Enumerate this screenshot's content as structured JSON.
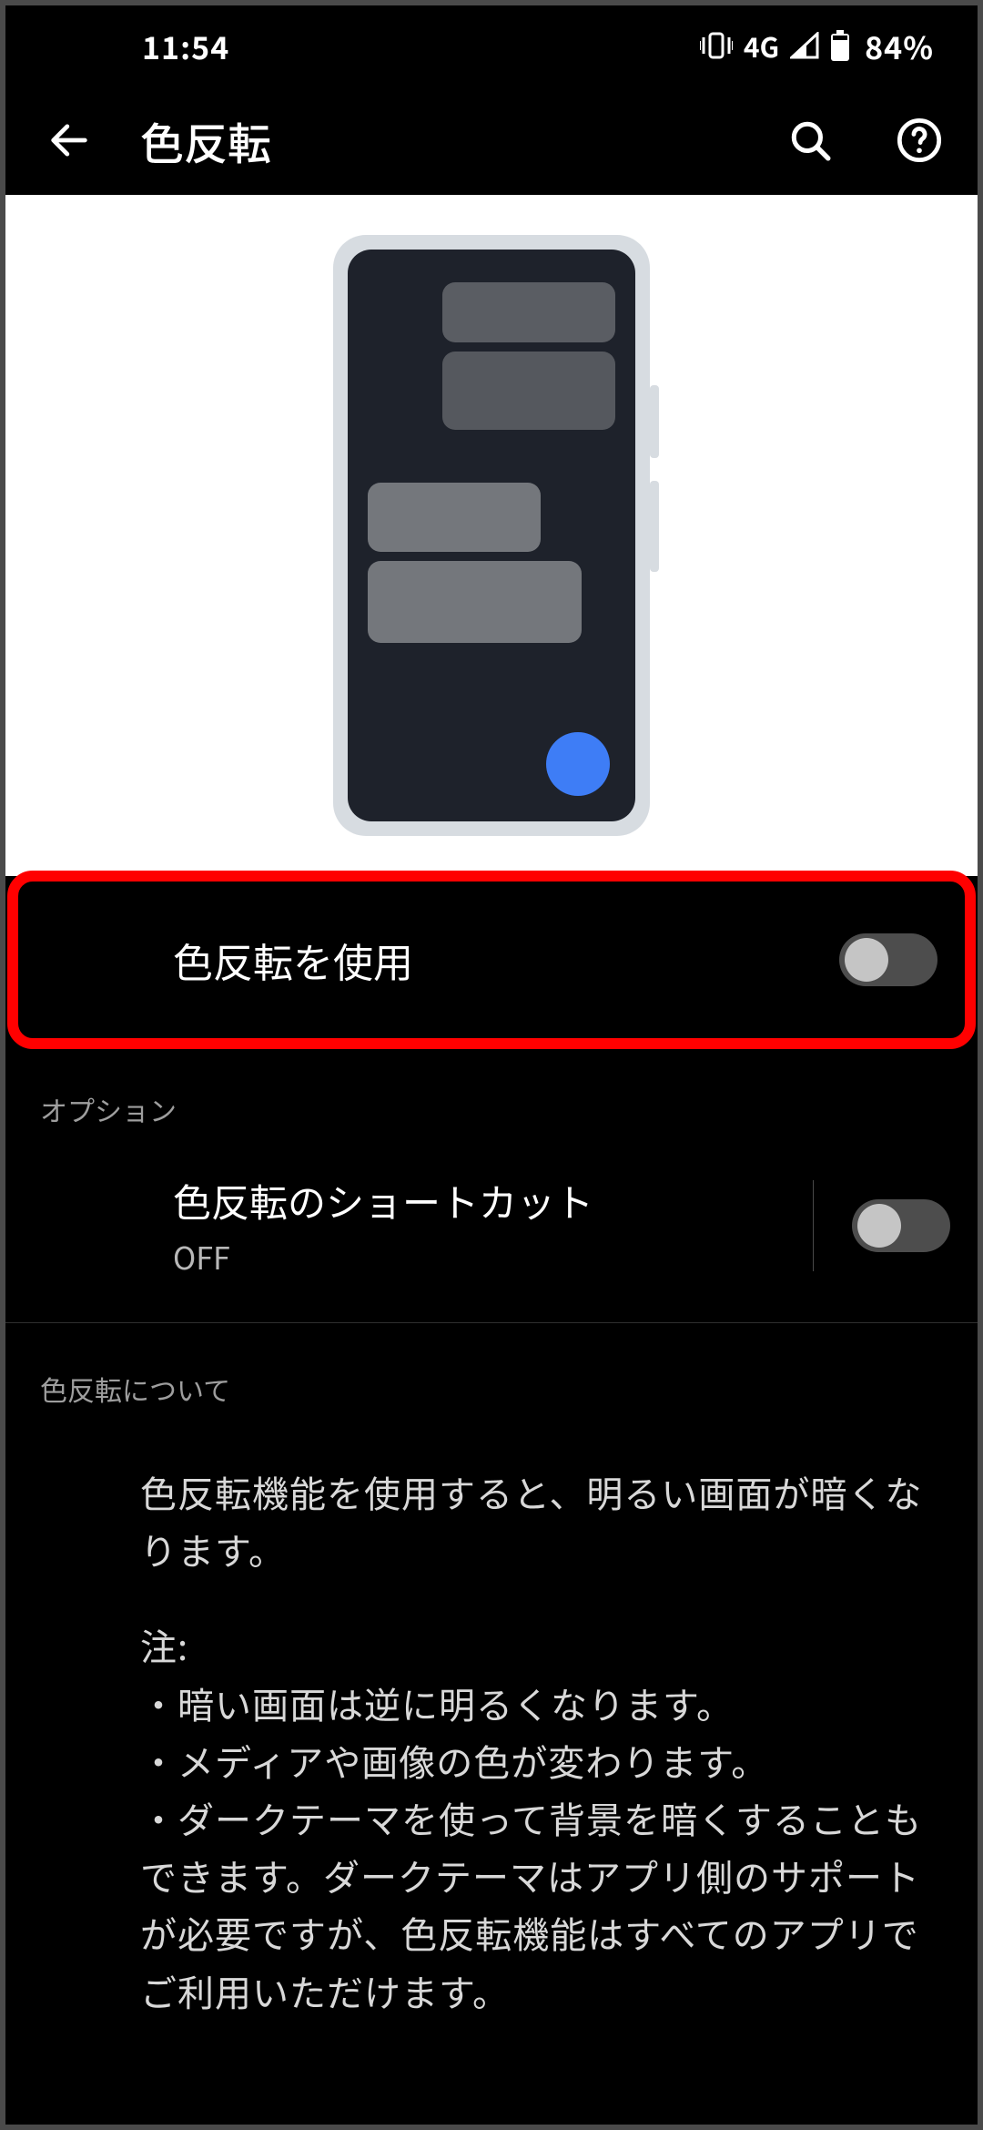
{
  "status_bar": {
    "time": "11:54",
    "network_label": "4G",
    "battery_percent": "84%"
  },
  "app_bar": {
    "title": "色反転"
  },
  "main_toggle": {
    "label": "色反転を使用",
    "enabled": false,
    "highlighted": true
  },
  "section_options_header": "オプション",
  "shortcut_row": {
    "title": "色反転のショートカット",
    "subtitle": "OFF",
    "enabled": false
  },
  "about": {
    "header": "色反転について",
    "paragraph1": "色反転機能を使用すると、明るい画面が暗くなります。",
    "note_label": "注:",
    "bullet1": "・暗い画面は逆に明るくなります。",
    "bullet2": "・メディアや画像の色が変わります。",
    "bullet3": "・ダークテーマを使って背景を暗くすることもできます。ダークテーマはアプリ側のサポートが必要ですが、色反転機能はすべてのアプリでご利用いただけます。"
  }
}
